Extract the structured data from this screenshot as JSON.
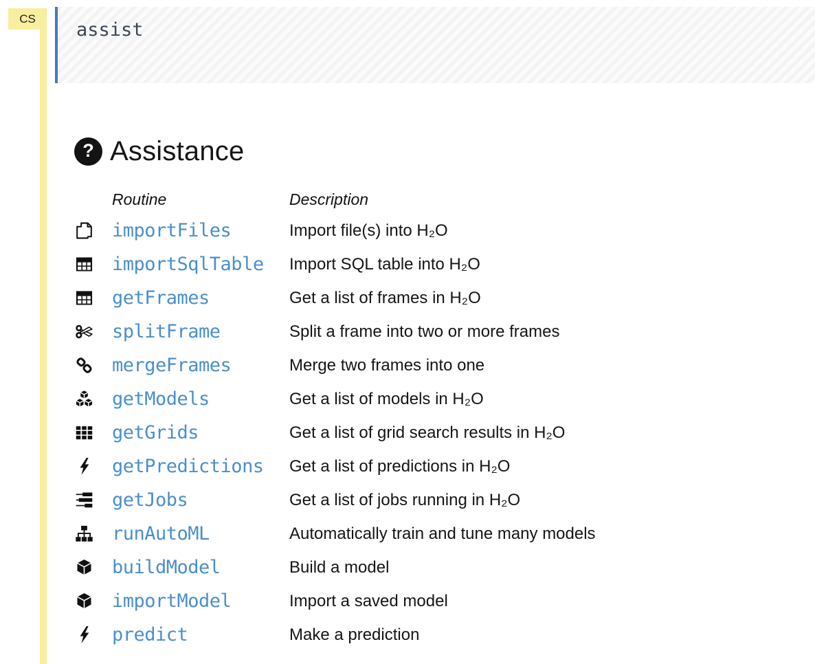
{
  "colors": {
    "link_blue": "#4a8fcb",
    "cell_border_blue": "#4a78b3",
    "gutter_yellow": "#f7ef9e"
  },
  "gutter": {
    "cell_flag": "CS"
  },
  "cell": {
    "code": "assist"
  },
  "icons": {
    "question_mark": "?"
  },
  "assist": {
    "title": "Assistance",
    "columns": {
      "routine": "Routine",
      "description": "Description"
    },
    "routines": [
      {
        "icon": "copy-icon",
        "name": "importFiles",
        "description": "Import file(s) into H₂O"
      },
      {
        "icon": "table-icon",
        "name": "importSqlTable",
        "description": "Import SQL table into H₂O"
      },
      {
        "icon": "table-icon",
        "name": "getFrames",
        "description": "Get a list of frames in H₂O"
      },
      {
        "icon": "scissors-icon",
        "name": "splitFrame",
        "description": "Split a frame into two or more frames"
      },
      {
        "icon": "link-icon",
        "name": "mergeFrames",
        "description": "Merge two frames into one"
      },
      {
        "icon": "cubes-icon",
        "name": "getModels",
        "description": "Get a list of models in H₂O"
      },
      {
        "icon": "grid-icon",
        "name": "getGrids",
        "description": "Get a list of grid search results in H₂O"
      },
      {
        "icon": "bolt-icon",
        "name": "getPredictions",
        "description": "Get a list of predictions in H₂O"
      },
      {
        "icon": "tasks-icon",
        "name": "getJobs",
        "description": "Get a list of jobs running in H₂O"
      },
      {
        "icon": "sitemap-icon",
        "name": "runAutoML",
        "description": "Automatically train and tune many models"
      },
      {
        "icon": "cube-icon",
        "name": "buildModel",
        "description": "Build a model"
      },
      {
        "icon": "cube-icon",
        "name": "importModel",
        "description": "Import a saved model"
      },
      {
        "icon": "bolt-icon",
        "name": "predict",
        "description": "Make a prediction"
      }
    ]
  }
}
